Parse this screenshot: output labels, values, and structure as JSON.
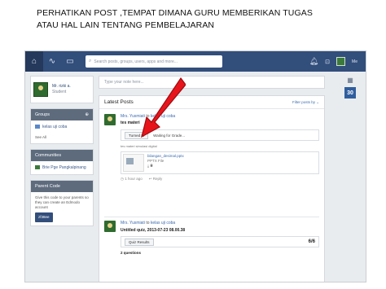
{
  "slide_title_line1": "PERHATIKAN POST ,TEMPAT DIMANA GURU MEMBERIKAN TUGAS",
  "slide_title_line2": "ATAU HAL LAIN TENTANG PEMBELAJARAN",
  "topbar": {
    "search_placeholder": "Search posts, groups, users, apps and more...",
    "user_label": "Me"
  },
  "profile": {
    "name": "Mr. rizki a.",
    "role": "Student"
  },
  "groups": {
    "header": "Groups",
    "items": [
      "kelas uji coba"
    ],
    "see_all": "See All"
  },
  "communities": {
    "header": "Communities",
    "items": [
      "Brie Pge Pangkalpinang"
    ]
  },
  "parent_code": {
    "header": "Parent Code",
    "text": "Give this code to your parents so they can create an Edmodo account",
    "code": "zf38ee"
  },
  "compose_placeholder": "Type your note here...",
  "posts": {
    "header": "Latest Posts",
    "filter": "Filter posts by",
    "post1": {
      "author": "Mrs. Yusmiati",
      "to": "to",
      "group": "kelas uji coba",
      "title": "tes materi",
      "turned_in": "Turned In",
      "status": "Waiting for Grade...",
      "note": "tes materi simulasi digital",
      "file_name": "bilangan_desimal.pptx",
      "file_type": "PPTX File",
      "time": "1 hour ago",
      "reply": "Reply"
    },
    "post2": {
      "author": "Mrs. Yusmiati",
      "to": "to",
      "group": "kelas uji coba",
      "title": "Untitled quiz, 2013-07-23 08.00.38",
      "quiz_button": "Quiz Results",
      "score": "6/6",
      "questions": "2 questions"
    }
  },
  "calendar_day": "30",
  "colors": {
    "topbar": "#324e7b",
    "arrow": "#e8141b",
    "accent": "#3c6bb0"
  }
}
